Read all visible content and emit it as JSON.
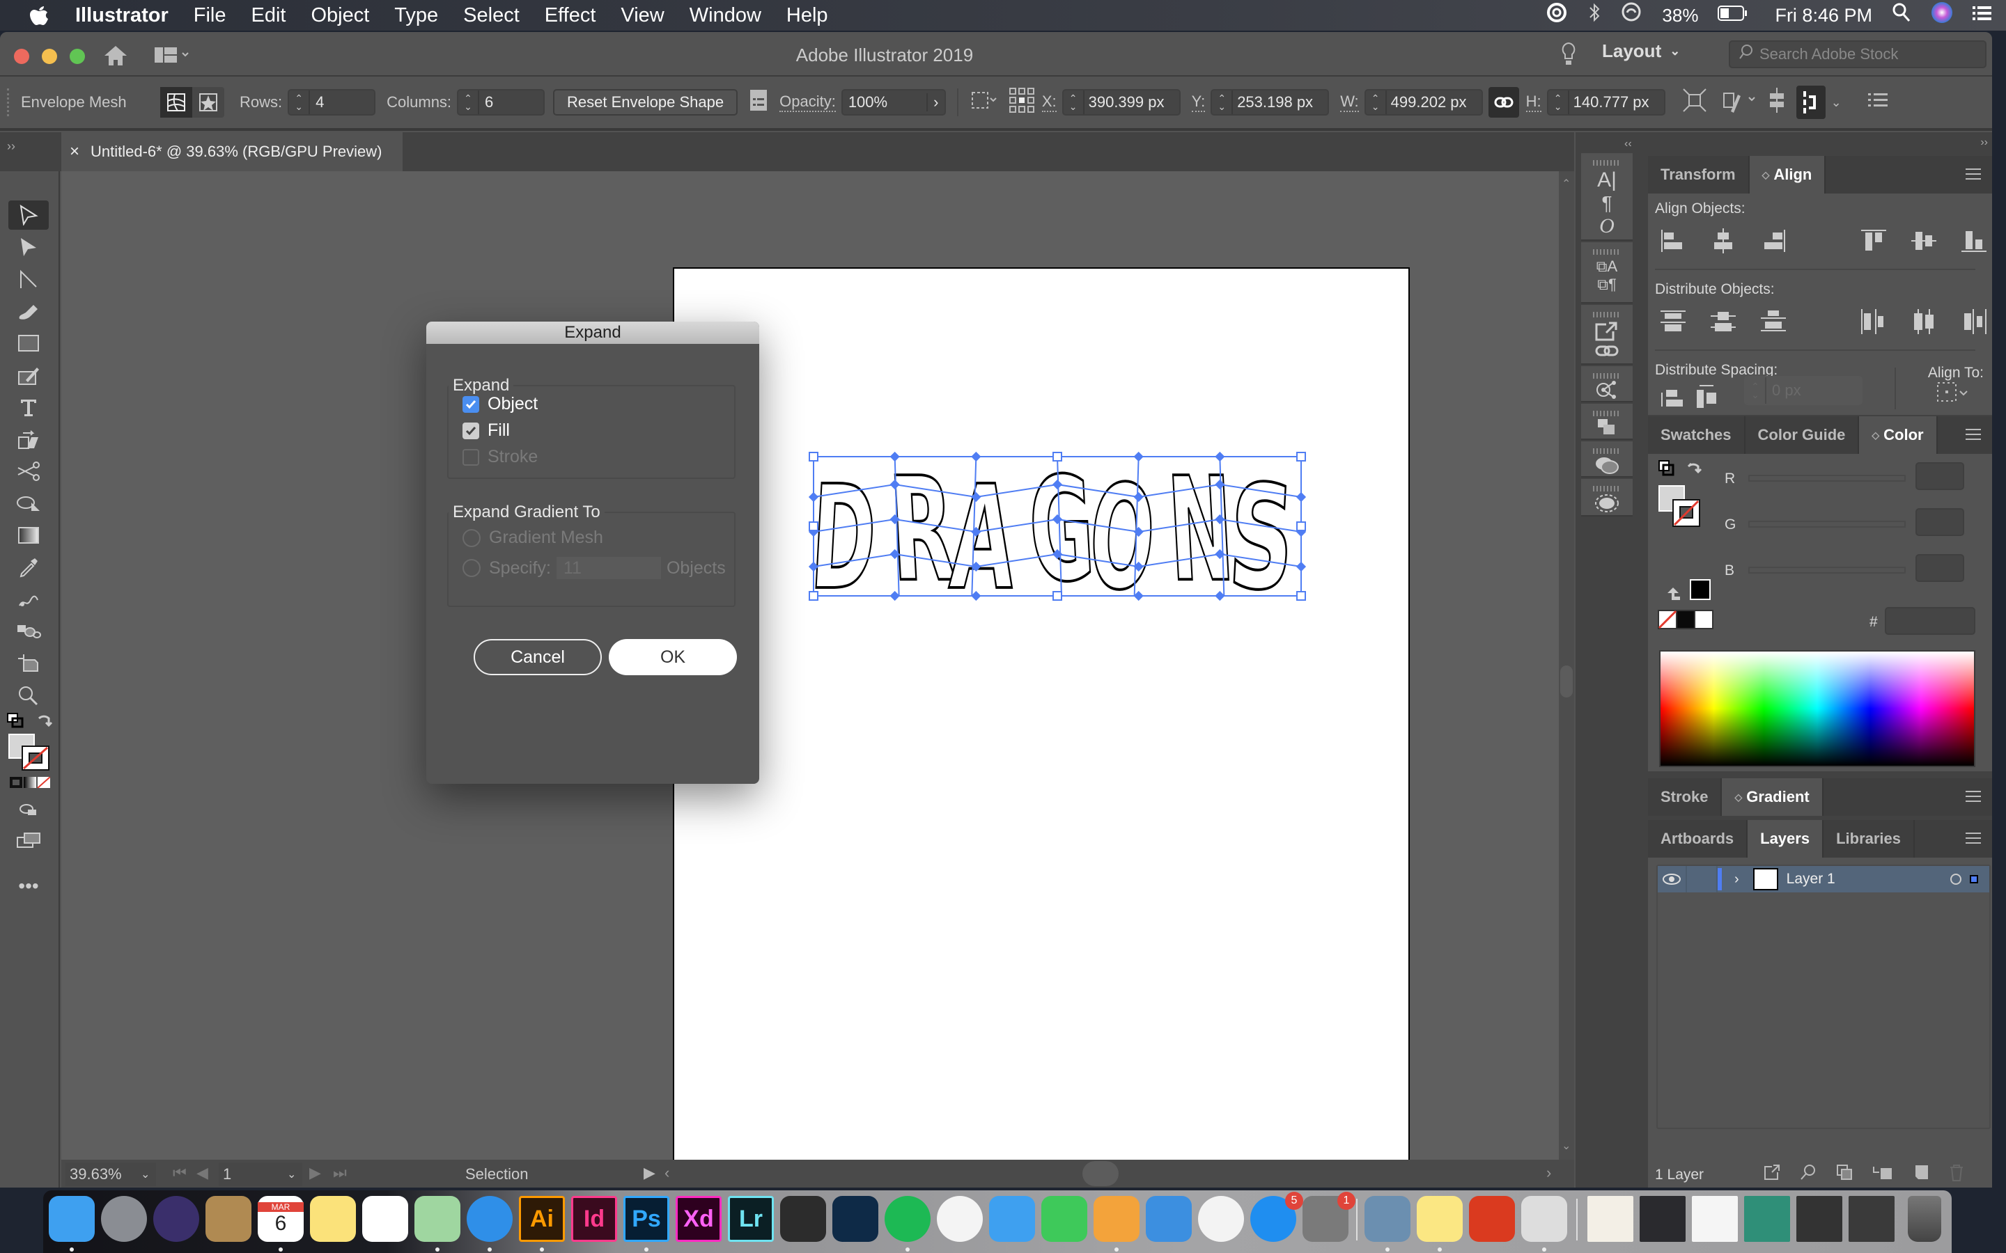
{
  "menubar": {
    "app_name": "Illustrator",
    "items": [
      "File",
      "Edit",
      "Object",
      "Type",
      "Select",
      "Effect",
      "View",
      "Window",
      "Help"
    ],
    "battery": "38%",
    "clock": "Fri 8:46 PM"
  },
  "window": {
    "title": "Adobe Illustrator 2019",
    "workspace": "Layout",
    "search_placeholder": "Search Adobe Stock"
  },
  "control_bar": {
    "selection_type": "Envelope Mesh",
    "rows_label": "Rows:",
    "rows_value": "4",
    "columns_label": "Columns:",
    "columns_value": "6",
    "reset_button": "Reset Envelope Shape",
    "opacity_label": "Opacity:",
    "opacity_value": "100%",
    "x_label": "X:",
    "x_value": "390.399 px",
    "y_label": "Y:",
    "y_value": "253.198 px",
    "w_label": "W:",
    "w_value": "499.202 px",
    "h_label": "H:",
    "h_value": "140.777 px"
  },
  "document_tab": {
    "close": "×",
    "title": "Untitled-6* @ 39.63% (RGB/GPU Preview)"
  },
  "artwork": {
    "text": "DRAGONS",
    "mesh_rows": 4,
    "mesh_columns": 6,
    "mesh_color": "#4f7df3"
  },
  "dialog": {
    "title": "Expand",
    "expand_group_label": "Expand",
    "options": [
      {
        "label": "Object",
        "checked": true,
        "enabled": true
      },
      {
        "label": "Fill",
        "checked": true,
        "enabled": true
      },
      {
        "label": "Stroke",
        "checked": false,
        "enabled": false
      }
    ],
    "gradient_group_label": "Expand Gradient To",
    "gradient_mesh_label": "Gradient Mesh",
    "specify_label": "Specify:",
    "specify_value": "11",
    "objects_label": "Objects",
    "cancel_button": "Cancel",
    "ok_button": "OK"
  },
  "status_bar": {
    "zoom": "39.63%",
    "artboard_number": "1",
    "tool_name": "Selection"
  },
  "align_panel": {
    "tabs": [
      "Transform",
      "Align"
    ],
    "active_tab": "Align",
    "align_objects_label": "Align Objects:",
    "distribute_objects_label": "Distribute Objects:",
    "distribute_spacing_label": "Distribute Spacing:",
    "spacing_value": "0 px",
    "align_to_label": "Align To:"
  },
  "color_panel": {
    "tabs": [
      "Swatches",
      "Color Guide",
      "Color"
    ],
    "active_tab": "Color",
    "r_label": "R",
    "g_label": "G",
    "b_label": "B",
    "hex_label": "#",
    "r_value": "",
    "g_value": "",
    "b_value": "",
    "hex_value": ""
  },
  "gradient_panel": {
    "tabs": [
      "Stroke",
      "Gradient"
    ],
    "active_tab": "Gradient"
  },
  "layers_panel": {
    "tabs": [
      "Artboards",
      "Layers",
      "Libraries"
    ],
    "active_tab": "Layers",
    "layers": [
      {
        "name": "Layer 1",
        "color": "#4f7df3",
        "visible": true
      }
    ],
    "footer_count": "1 Layer"
  },
  "dock": {
    "apps": [
      {
        "name": "Finder",
        "label": "",
        "running": true
      },
      {
        "name": "Launchpad",
        "label": "",
        "running": false
      },
      {
        "name": "Siri",
        "label": "",
        "running": false
      },
      {
        "name": "Contacts",
        "label": "",
        "running": false
      },
      {
        "name": "Calendar",
        "label": "6",
        "month": "MAR",
        "running": true
      },
      {
        "name": "Notes",
        "label": "",
        "running": false
      },
      {
        "name": "Reminders",
        "label": "",
        "running": false
      },
      {
        "name": "Maps",
        "label": "",
        "running": true
      },
      {
        "name": "Safari",
        "label": "",
        "running": true
      },
      {
        "name": "Illustrator",
        "label": "Ai",
        "running": true
      },
      {
        "name": "InDesign",
        "label": "Id",
        "running": false
      },
      {
        "name": "Photoshop",
        "label": "Ps",
        "running": true
      },
      {
        "name": "Adobe XD",
        "label": "Xd",
        "running": false
      },
      {
        "name": "Lightroom",
        "label": "Lr",
        "running": false
      },
      {
        "name": "Figma",
        "label": "",
        "running": false
      },
      {
        "name": "Kindle",
        "label": "",
        "running": false
      },
      {
        "name": "Spotify",
        "label": "",
        "running": true
      },
      {
        "name": "Photos",
        "label": "",
        "running": false
      },
      {
        "name": "Messages",
        "label": "",
        "running": false
      },
      {
        "name": "FaceTime",
        "label": "",
        "running": false
      },
      {
        "name": "Pages",
        "label": "",
        "running": true
      },
      {
        "name": "Keynote",
        "label": "",
        "running": false
      },
      {
        "name": "iTunes",
        "label": "",
        "running": false
      },
      {
        "name": "App Store",
        "label": "",
        "badge": "5",
        "running": false
      },
      {
        "name": "System Preferences",
        "label": "",
        "badge": "1",
        "running": false
      },
      {
        "name": "Preview",
        "label": "",
        "running": true
      },
      {
        "name": "Stickies",
        "label": "",
        "running": true
      },
      {
        "name": "Creative Cloud",
        "label": "",
        "running": false
      },
      {
        "name": "Printer",
        "label": "",
        "running": true
      }
    ]
  }
}
